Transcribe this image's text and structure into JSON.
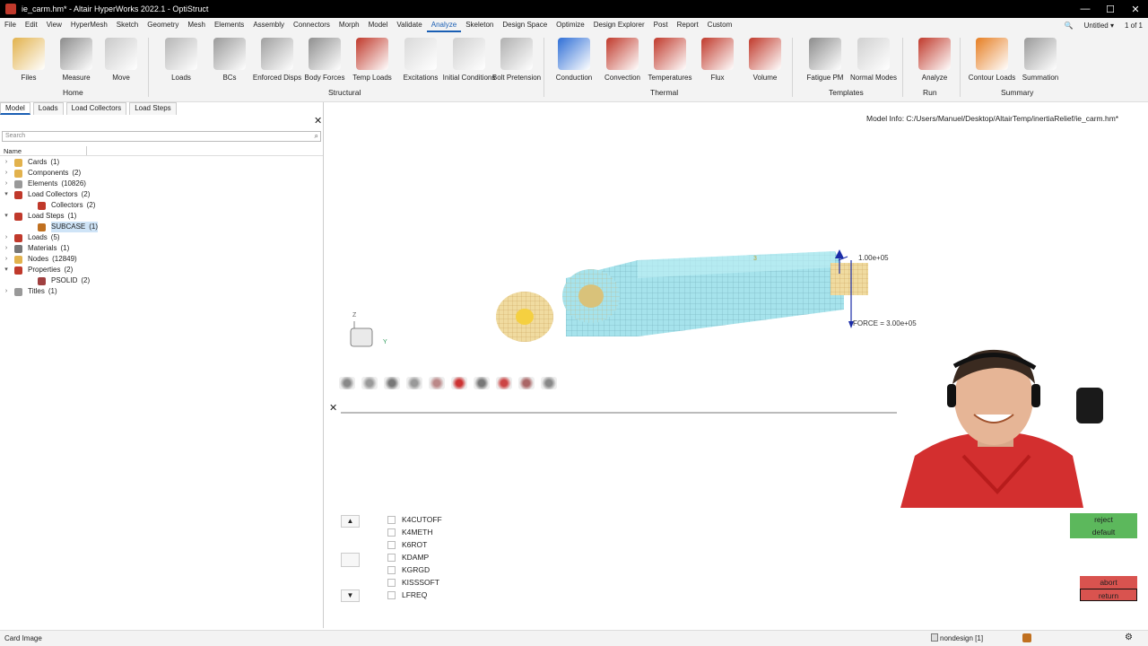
{
  "titlebar": {
    "title": "ie_carm.hm* - Altair HyperWorks 2022.1 - OptiStruct",
    "minimize": "—",
    "maximize": "☐",
    "close": "✕"
  },
  "menu": {
    "items": [
      "File",
      "Edit",
      "View",
      "HyperMesh",
      "Sketch",
      "Geometry",
      "Mesh",
      "Elements",
      "Assembly",
      "Connectors",
      "Morph",
      "Model",
      "Validate",
      "Analyze",
      "Skeleton",
      "Design Space",
      "Optimize",
      "Design Explorer",
      "Post",
      "Report",
      "Custom"
    ],
    "active": "Analyze",
    "search_icon": "🔍",
    "session": "Untitled ▾",
    "pages": "1 of 1"
  },
  "ribbon": {
    "tools": [
      {
        "label": "Files",
        "icon": "folder-icon",
        "color": "#e2b24d"
      },
      {
        "label": "Measure",
        "icon": "measure-icon",
        "color": "#8c8c8c"
      },
      {
        "label": "Move",
        "icon": "move-icon",
        "color": "#c9c9c9"
      },
      {
        "label": "Loads",
        "icon": "loads-icon",
        "color": "#b6b6b6"
      },
      {
        "label": "BCs",
        "icon": "bcs-icon",
        "color": "#9a9a9a"
      },
      {
        "label": "Enforced Disps",
        "icon": "enforced-disps-icon",
        "color": "#a0a0a0"
      },
      {
        "label": "Body Forces",
        "icon": "body-forces-icon",
        "color": "#8f8f8f"
      },
      {
        "label": "Temp Loads",
        "icon": "temp-loads-icon",
        "color": "#c0392b"
      },
      {
        "label": "Excitations",
        "icon": "excitations-icon",
        "color": "#d9d9d9"
      },
      {
        "label": "Initial Conditions",
        "icon": "initial-conditions-icon",
        "color": "#d0d0d0"
      },
      {
        "label": "Bolt Pretension",
        "icon": "bolt-pretension-icon",
        "color": "#b0b0b0"
      },
      {
        "label": "Conduction",
        "icon": "conduction-icon",
        "color": "#2f6fd6"
      },
      {
        "label": "Convection",
        "icon": "convection-icon",
        "color": "#c0392b"
      },
      {
        "label": "Temperatures",
        "icon": "temperatures-icon",
        "color": "#c0392b"
      },
      {
        "label": "Flux",
        "icon": "flux-icon",
        "color": "#c0392b"
      },
      {
        "label": "Volume",
        "icon": "volume-icon",
        "color": "#c0392b"
      },
      {
        "label": "Fatigue PM",
        "icon": "fatigue-pm-icon",
        "color": "#8c8c8c"
      },
      {
        "label": "Normal Modes",
        "icon": "normal-modes-icon",
        "color": "#d0d0d0"
      },
      {
        "label": "Analyze",
        "icon": "analyze-icon",
        "color": "#c0392b"
      },
      {
        "label": "Contour Loads",
        "icon": "contour-loads-icon",
        "color": "#e67e22"
      },
      {
        "label": "Summation",
        "icon": "summation-icon",
        "color": "#9a9a9a"
      }
    ],
    "groups": [
      "Home",
      "Structural",
      "Thermal",
      "Templates",
      "Run",
      "Summary"
    ]
  },
  "leftpanel": {
    "tabs": [
      "Model",
      "Loads",
      "Load Collectors",
      "Load Steps"
    ],
    "active_tab": "Model",
    "close": "✕",
    "search_placeholder": "Search",
    "column": "Name",
    "tree": [
      {
        "label": "Cards",
        "count": "(1)",
        "level": 0,
        "icon": "cards-icon",
        "color": "#e2b24d"
      },
      {
        "label": "Components",
        "count": "(2)",
        "level": 0,
        "icon": "components-icon",
        "color": "#e2b24d"
      },
      {
        "label": "Elements",
        "count": "(10826)",
        "level": 0,
        "icon": "elements-icon",
        "color": "#999"
      },
      {
        "label": "Load Collectors",
        "count": "(2)",
        "level": 0,
        "icon": "load-collectors-icon",
        "color": "#c0392b",
        "open": true
      },
      {
        "label": "Collectors",
        "count": "(2)",
        "level": 1,
        "icon": "collectors-icon",
        "color": "#c0392b"
      },
      {
        "label": "Load Steps",
        "count": "(1)",
        "level": 0,
        "icon": "load-steps-icon",
        "color": "#c0392b",
        "open": true
      },
      {
        "label": "SUBCASE",
        "count": "(1)",
        "level": 1,
        "icon": "subcase-icon",
        "color": "#c07020",
        "selected": true
      },
      {
        "label": "Loads",
        "count": "(5)",
        "level": 0,
        "icon": "loads-icon",
        "color": "#c0392b"
      },
      {
        "label": "Materials",
        "count": "(1)",
        "level": 0,
        "icon": "materials-icon",
        "color": "#777"
      },
      {
        "label": "Nodes",
        "count": "(12849)",
        "level": 0,
        "icon": "nodes-icon",
        "color": "#e2b24d"
      },
      {
        "label": "Properties",
        "count": "(2)",
        "level": 0,
        "icon": "properties-icon",
        "color": "#c0392b",
        "open": true
      },
      {
        "label": "PSOLID",
        "count": "(2)",
        "level": 1,
        "icon": "psolid-icon",
        "color": "#a04040"
      },
      {
        "label": "Titles",
        "count": "(1)",
        "level": 0,
        "icon": "titles-icon",
        "color": "#999"
      }
    ]
  },
  "viewport": {
    "model_info": "Model Info: C:/Users/Manuel/Desktop/AltairTemp/inertiaRelief/ie_carm.hm*",
    "force_label": "FORCE = 3.00e+05",
    "moment_label": "1.00e+05",
    "axis_z": "Z",
    "axis_y": "Y",
    "node_label": "3"
  },
  "cardpanel": {
    "items": [
      "K4CUTOFF",
      "K4METH",
      "K6ROT",
      "KDAMP",
      "KGRGD",
      "KISSSOFT",
      "LFREQ"
    ],
    "buttons": {
      "reject": "reject",
      "default": "default",
      "abort": "abort",
      "return": "return"
    },
    "colors": {
      "green": "#5cb85c",
      "red": "#d9534f"
    }
  },
  "statusbar": {
    "left": "Card Image",
    "right": "nondesign [1]"
  }
}
